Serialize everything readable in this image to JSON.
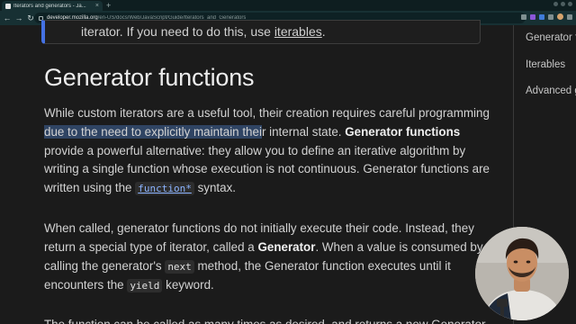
{
  "browser": {
    "tab_title": "Iterators and generators - Ja...",
    "tab_close": "×",
    "new_tab": "+",
    "nav": {
      "back": "←",
      "forward": "→",
      "reload": "↻"
    },
    "url_domain": "developer.mozilla.org",
    "url_path": "/en-US/docs/Web/JavaScript/Guide/Iterators_and_Generators"
  },
  "note": {
    "text_before": "iterator. If you need to do this, use ",
    "link": "iterables",
    "text_after": "."
  },
  "heading": "Generator functions",
  "paragraph1": {
    "l1": "While custom iterators are a useful tool, their creation requires careful programming",
    "l2_highlight": "due to the need to explicitly maintain thei",
    "l2_rest": "r internal state. ",
    "l2_bold": "Generator functions",
    "l3": "provide a powerful alternative: they allow you to define an iterative algorithm by",
    "l4": "writing a single function whose execution is not continuous. Generator functions are",
    "l5_before": "written using the ",
    "l5_code": "function*",
    "l5_after": " syntax."
  },
  "paragraph2": {
    "l1": "When called, generator functions do not initially execute their code. Instead, they",
    "l2_before": "return a special type of iterator, called a ",
    "l2_bold": "Generator",
    "l2_after": ". When a value is consumed by",
    "l3_before": "calling the generator's ",
    "l3_code": "next",
    "l3_after": " method, the Generator function executes until it",
    "l4_before": "encounters the ",
    "l4_code": "yield",
    "l4_after": " keyword."
  },
  "paragraph3": {
    "l1": "The function can be called as many times as desired, and returns a new Generator"
  },
  "toc": {
    "items": [
      "Generator fu",
      "Iterables",
      "Advanced g"
    ]
  },
  "colors": {
    "background": "#1b1b1b",
    "note_accent": "#4471e3",
    "highlight": "#2f4463",
    "browser_chrome": "#173033"
  }
}
